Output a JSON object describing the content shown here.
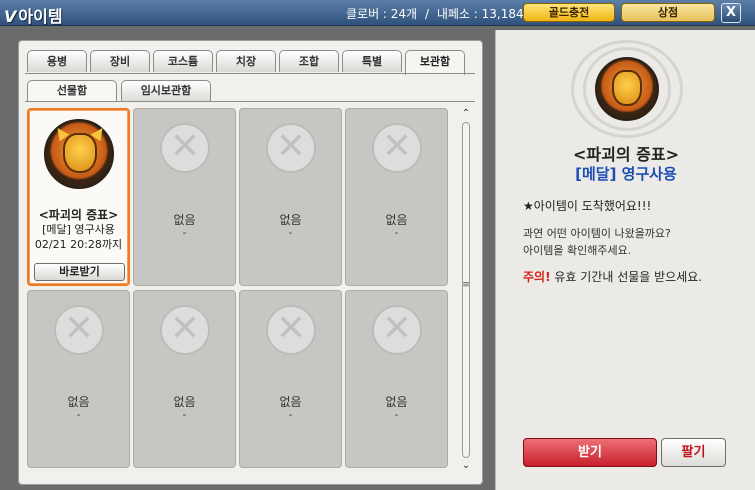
{
  "titlebar": {
    "app_title": "아이템",
    "clover_label": "클로버 : 24개",
    "separator": "/",
    "wallet_label": "내페소 : 13,184",
    "gold_charge_button": "골드충전",
    "shop_button": "상점",
    "close_button": "X"
  },
  "tabs": [
    "용병",
    "장비",
    "코스튬",
    "치장",
    "조합",
    "특별",
    "보관함"
  ],
  "active_tab": "보관함",
  "subtabs": [
    "선물함",
    "임시보관함"
  ],
  "active_subtab": "선물함",
  "grid": {
    "selected_item": {
      "name": "<파괴의 증표>",
      "type": "[메달] 영구사용",
      "date": "02/21 20:28까지",
      "receive_button": "바로받기"
    },
    "empty_label": "없음",
    "empty_dash": "-"
  },
  "detail": {
    "name": "<파괴의 증표>",
    "subtitle": "[메달] 영구사용",
    "arrived": "★아이템이 도착했어요!!!",
    "question_line1": "과연 어떤 아이템이 나왔을까요?",
    "question_line2": "아이템을 확인해주세요.",
    "warning_prefix": "주의!",
    "warning_text": " 유효 기간내 선물을 받으세요.",
    "accept_button": "받기",
    "sell_button": "팔기"
  },
  "colors": {
    "accent_orange": "#f07a21",
    "link_blue": "#1d4fb3",
    "warning_red": "#d4221b",
    "accept_red": "#c8202b"
  }
}
